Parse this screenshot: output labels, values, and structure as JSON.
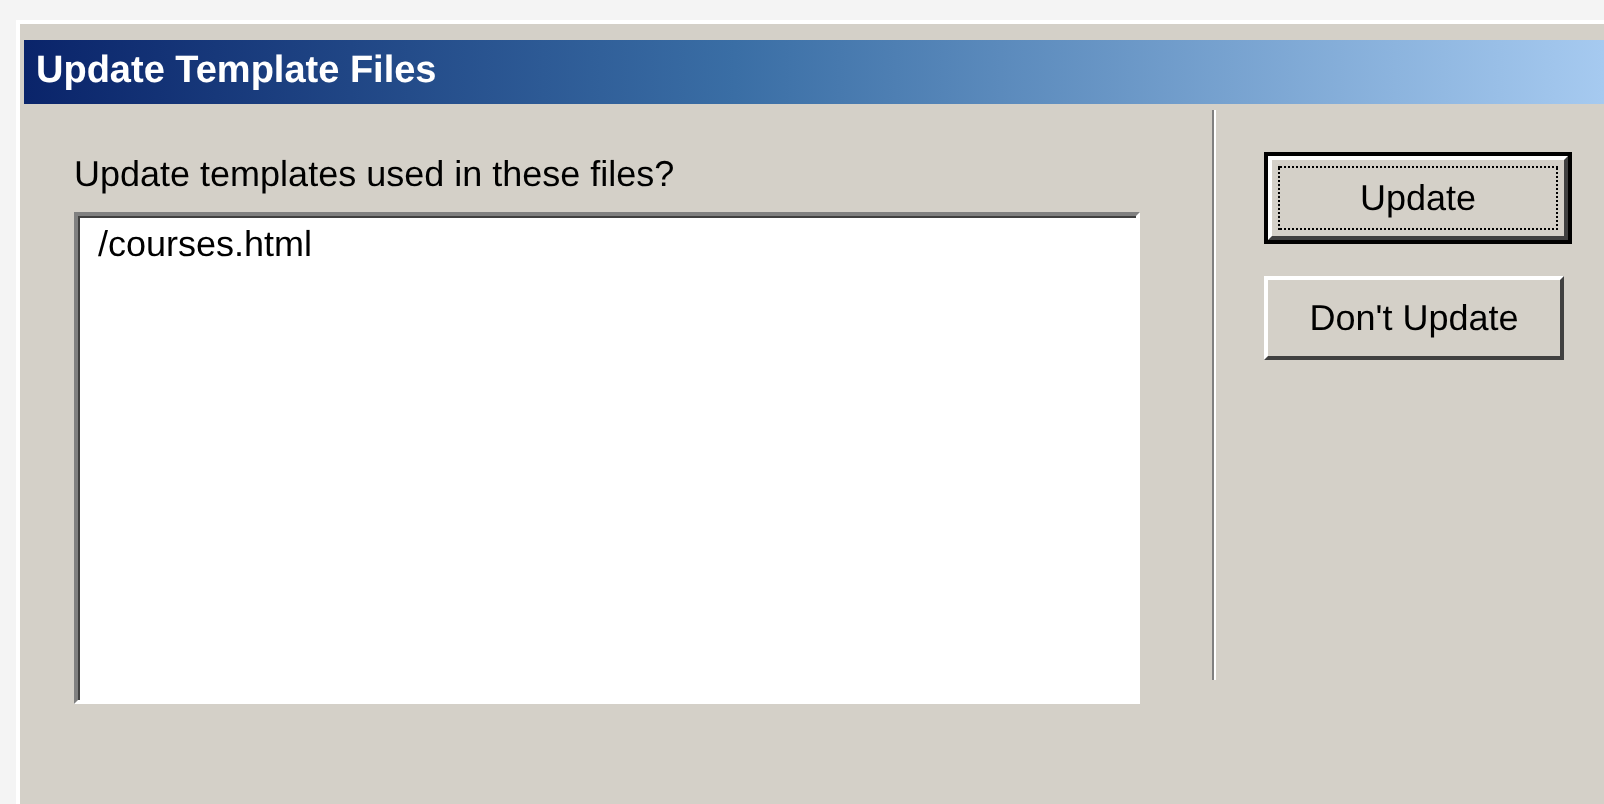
{
  "window": {
    "title": "Update Template Files"
  },
  "prompt": "Update templates used in these files?",
  "files": [
    {
      "name": "/courses.html",
      "selected": false
    }
  ],
  "buttons": [
    {
      "label": "Update",
      "default": true
    },
    {
      "label": "Don't Update",
      "default": false
    }
  ]
}
